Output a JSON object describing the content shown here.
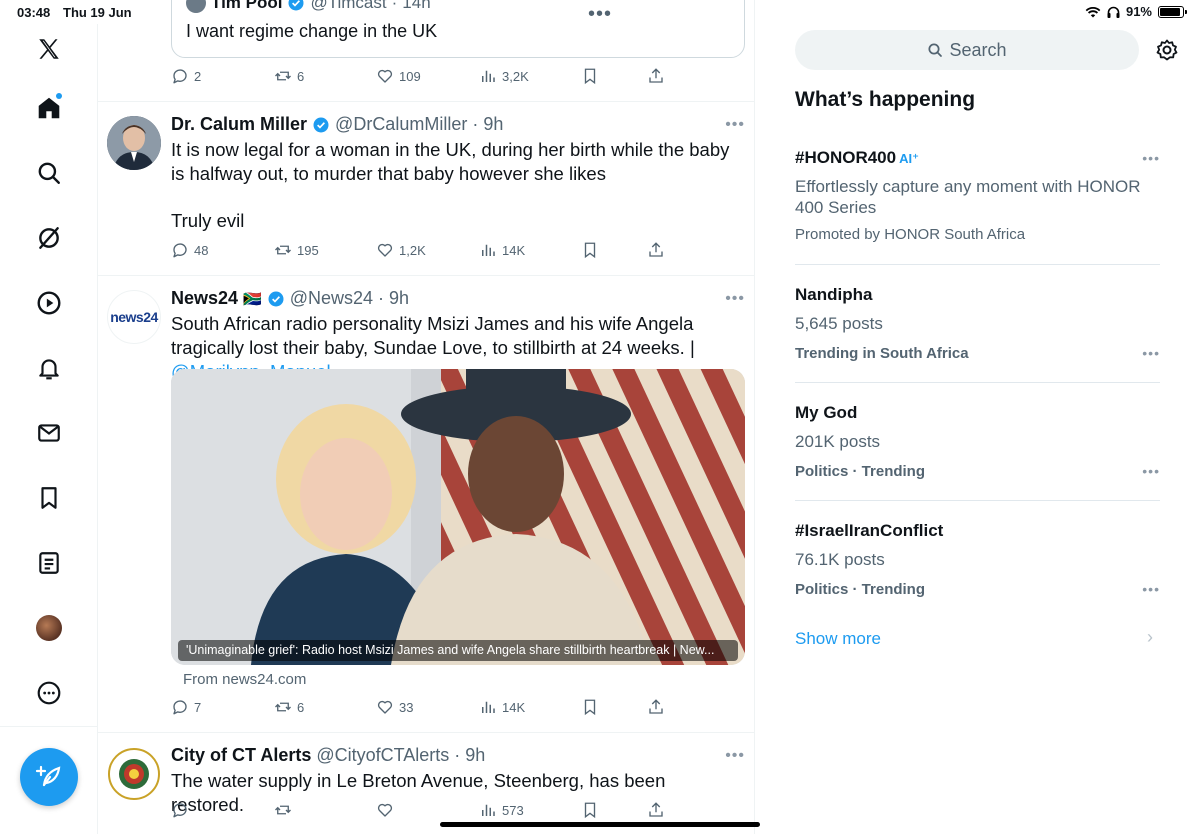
{
  "status": {
    "time": "03:48",
    "date": "Thu 19 Jun",
    "battery": "91%",
    "battery_level": 0.91
  },
  "nav": {
    "items": [
      "x-logo",
      "home",
      "search",
      "grok",
      "video",
      "notifications",
      "messages",
      "bookmarks",
      "lists",
      "profile",
      "more"
    ]
  },
  "quoted": {
    "name": "Tim Pool",
    "handle": "@Timcast",
    "time": "14h",
    "text": "I want regime change in the UK"
  },
  "tweet0_actions": {
    "replies": "2",
    "reposts": "6",
    "likes": "109",
    "views": "3,2K"
  },
  "tweets": [
    {
      "name": "Dr. Calum Miller",
      "handle": "@DrCalumMiller",
      "dot": "·",
      "time": "9h",
      "text1": "It is now legal for a woman in the UK, during her birth while the baby is halfway out, to murder that baby however she likes",
      "text2": "Truly evil",
      "replies": "48",
      "reposts": "195",
      "likes": "1,2K",
      "views": "14K"
    },
    {
      "name": "News24",
      "flag": "🇿🇦",
      "handle": "@News24",
      "dot": "·",
      "time": "9h",
      "text": "South African radio personality Msizi James and his wife Angela tragically lost their baby, Sundae Love, to stillbirth at 24 weeks. | ",
      "mention": "@Marilynn_Manuel",
      "media_caption": "'Unimaginable grief': Radio host Msizi James and wife Angela share stillbirth heartbreak | New...",
      "from": "From news24.com",
      "replies": "7",
      "reposts": "6",
      "likes": "33",
      "views": "14K",
      "avatar_text": "news24"
    },
    {
      "name": "City of CT Alerts",
      "handle": "@CityofCTAlerts",
      "dot": "·",
      "time": "9h",
      "text": "The water supply in Le Breton Avenue, Steenberg, has been restored.",
      "views": "573"
    }
  ],
  "right": {
    "search_placeholder": "Search",
    "title": "What’s happening",
    "trends": [
      {
        "name": "#HONOR400",
        "badge": "AI⁺",
        "sub": "Effortlessly capture any moment with HONOR 400 Series",
        "meta": "Promoted by HONOR South Africa"
      },
      {
        "name": "Nandipha",
        "sub": "5,645 posts",
        "meta": "Trending in South Africa"
      },
      {
        "name": "My God",
        "sub": "201K posts",
        "meta": "Politics · Trending"
      },
      {
        "name": "#IsraelIranConflict",
        "sub": "76.1K posts",
        "meta": "Politics · Trending"
      }
    ],
    "show_more": "Show more"
  },
  "colors": {
    "accent": "#1d9bf0",
    "text": "#0f1419",
    "secondary": "#536471"
  }
}
